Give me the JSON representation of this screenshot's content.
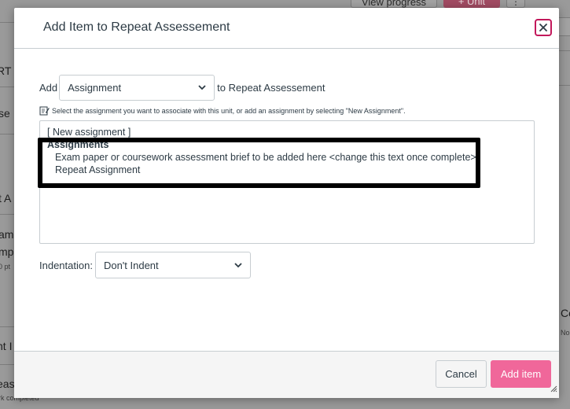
{
  "background": {
    "view_progress_label": "View progress",
    "unit_button_label": "+ Unit",
    "more_button_label": "⋮",
    "left_fragments": [
      "RT",
      "se",
      "t A",
      "am",
      "mp",
      "0 pt",
      "nt I",
      "eas",
      "rk completed"
    ],
    "right_fragments": [
      "Co",
      "No"
    ]
  },
  "modal": {
    "title": "Add Item to Repeat Assessement",
    "close_icon": "close-icon",
    "add_prefix": "Add",
    "item_type_selected": "Assignment",
    "add_suffix": "to Repeat Assessement",
    "hint_icon": "edit-icon",
    "hint_text": "Select the assignment you want to associate with this unit, or add an assignment by selecting \"New Assignment\".",
    "list": {
      "new_option": "[ New assignment ]",
      "group_label": "Assignments",
      "items": [
        "Exam paper or coursework assessment brief to be added here <change this text once complete>",
        "Repeat Assignment"
      ]
    },
    "indentation_label": "Indentation:",
    "indentation_selected": "Don't Indent",
    "cancel_label": "Cancel",
    "add_item_label": "Add item"
  },
  "colors": {
    "accent": "#f0679a",
    "close_border": "#c2185b",
    "text": "#2d3b45",
    "border": "#c7cdd1"
  }
}
